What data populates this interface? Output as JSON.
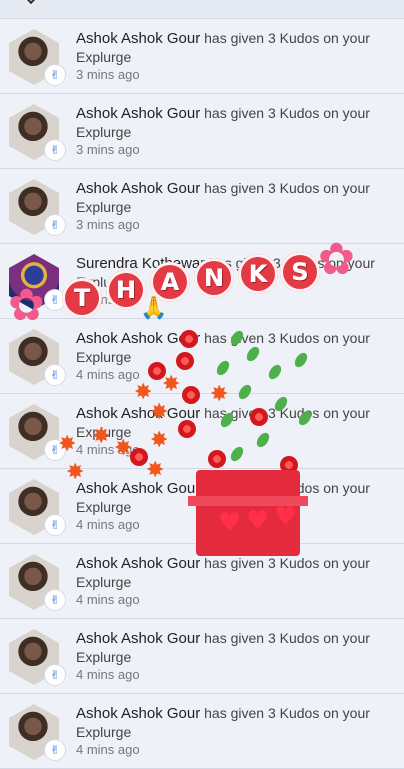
{
  "notifications": [
    {
      "name": "Ashok Ashok Gour",
      "message": "has given 3 Kudos on your Explurge",
      "time": "3 mins ago",
      "badge": "✌"
    },
    {
      "name": "Ashok Ashok Gour",
      "message": "has given 3 Kudos on your Explurge",
      "time": "3 mins ago",
      "badge": "✌"
    },
    {
      "name": "Ashok Ashok Gour",
      "message": "has given 3 Kudos on your Explurge",
      "time": "3 mins ago",
      "badge": "✌"
    },
    {
      "name": "Surendra Kothewar",
      "message": "has given 3 Kudos on your Explurge",
      "time": "3 mins ago",
      "badge": "✌"
    },
    {
      "name": "Ashok Ashok Gour",
      "message": "has given 3 Kudos on your Explurge",
      "time": "4 mins ago",
      "badge": "✌"
    },
    {
      "name": "Ashok Ashok Gour",
      "message": "has given 3 Kudos on your Explurge",
      "time": "4 mins ago",
      "badge": "✌"
    },
    {
      "name": "Ashok Ashok Gour",
      "message": "has given 3 Kudos on your Explurge",
      "time": "4 mins ago",
      "badge": "✌"
    },
    {
      "name": "Ashok Ashok Gour",
      "message": "has given 3 Kudos on your Explurge",
      "time": "4 mins ago",
      "badge": "✌"
    },
    {
      "name": "Ashok Ashok Gour",
      "message": "has given 3 Kudos on your Explurge",
      "time": "4 mins ago",
      "badge": "✌"
    },
    {
      "name": "Ashok Ashok Gour",
      "message": "has given 3 Kudos on your Explurge",
      "time": "4 mins ago",
      "badge": "✌"
    }
  ],
  "overlay": {
    "thanks_letters": [
      "T",
      "H",
      "A",
      "N",
      "K",
      "S"
    ],
    "flower_icon": "✿",
    "hands_icon": "🙏",
    "heart_icon": "♥",
    "maple_icon": "✸",
    "accent_red": "#e33a45",
    "leaf_green": "#4db04a"
  }
}
